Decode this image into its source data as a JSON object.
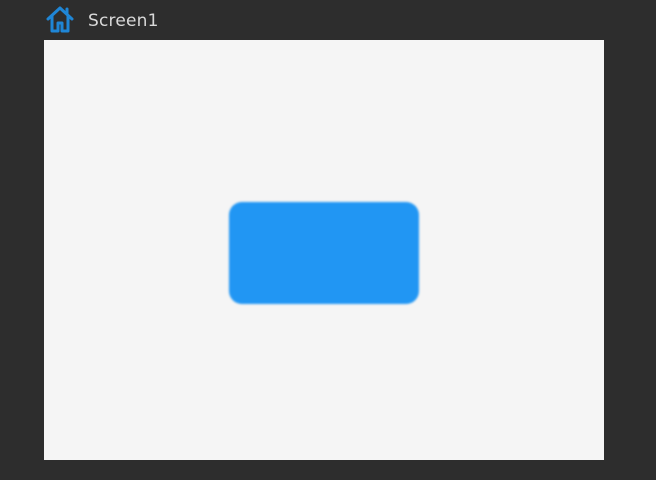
{
  "header": {
    "home_icon": "home-icon",
    "screen_title": "Screen1"
  },
  "canvas": {
    "background": "#f5f5f5",
    "shape": {
      "type": "rounded-rectangle",
      "fill": "#2196f3"
    }
  },
  "colors": {
    "app_background": "#2d2d2d",
    "title_text": "#d9d9d9",
    "accent": "#1f86d6"
  }
}
